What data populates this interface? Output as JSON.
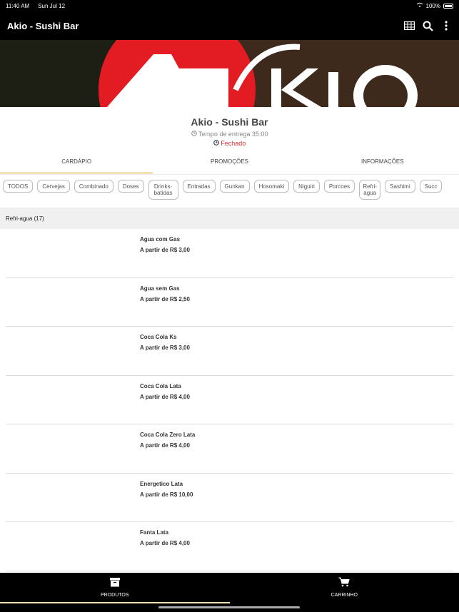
{
  "status": {
    "time": "11:40 AM",
    "date": "Sun Jul 12",
    "battery": "100%"
  },
  "app": {
    "title": "Akio - Sushi Bar"
  },
  "store": {
    "name": "Akio - Sushi Bar",
    "delivery_text": "Tempo de entrega 35:00",
    "status_text": "Fechado"
  },
  "tabs": [
    "CARDÁPIO",
    "PROMOÇÕES",
    "INFORMAÇÕES"
  ],
  "categories": [
    "TODOS",
    "Cervejas",
    "Combinado",
    "Doses",
    "Drinks-batidas",
    "Entradas",
    "Gunkan",
    "Hosomaki",
    "Niguiri",
    "Porcoes",
    "Refri-agua",
    "Sashimi",
    "Succ"
  ],
  "section": {
    "title": "Refri-agua (17)"
  },
  "products": [
    {
      "name": "Agua com Gas",
      "price": "A partir de R$ 3,00"
    },
    {
      "name": "Agua sem Gas",
      "price": "A partir de R$ 2,50"
    },
    {
      "name": "Coca Cola Ks",
      "price": "A partir de R$ 3,00"
    },
    {
      "name": "Coca Cola Lata",
      "price": "A partir de R$ 4,00"
    },
    {
      "name": "Coca Cola Zero Lata",
      "price": "A partir de R$ 4,00"
    },
    {
      "name": "Energetico Lata",
      "price": "A partir de R$ 10,00"
    },
    {
      "name": "Fanta Lata",
      "price": "A partir de R$ 4,00"
    }
  ],
  "bottom_nav": {
    "products_label": "PRODUTOS",
    "cart_label": "CARRINHO"
  },
  "colors": {
    "accent": "#f3e0b5",
    "closed": "#d32f2f",
    "bar": "#000000"
  },
  "icons": {
    "table": "table-icon",
    "search": "search-icon",
    "more": "more-vertical-icon",
    "clock": "clock-icon",
    "box": "box-icon",
    "cart": "cart-icon"
  }
}
